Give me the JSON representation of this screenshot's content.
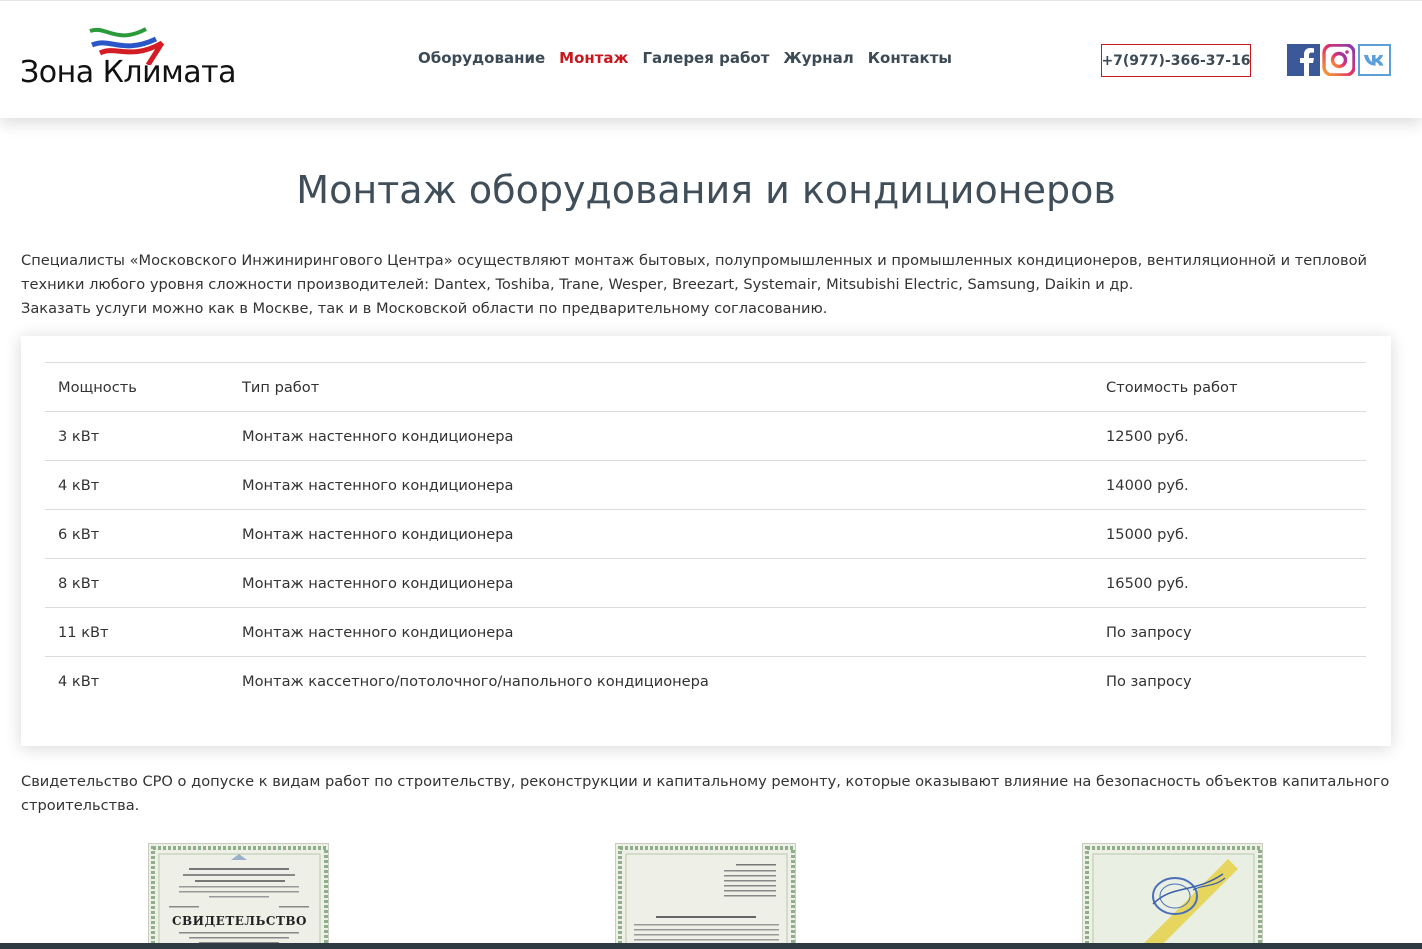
{
  "header": {
    "logo_text": "Зона Климата",
    "nav": [
      {
        "label": "Оборудование",
        "active": false
      },
      {
        "label": "Монтаж",
        "active": true
      },
      {
        "label": "Галерея работ",
        "active": false
      },
      {
        "label": "Журнал",
        "active": false
      },
      {
        "label": "Контакты",
        "active": false
      }
    ],
    "phone": "+7(977)-366-37-16",
    "social": [
      "facebook-icon",
      "instagram-icon",
      "vk-icon"
    ]
  },
  "main": {
    "title": "Монтаж оборудования и кондиционеров",
    "intro_line_1": "Специалисты «Московского Инжинирингового Центра» осуществляют монтаж бытовых, полупромышленных и промышленных кондиционеров, вентиляционной и тепловой техники любого уровня сложности производителей: Dantex, Toshiba, Trane, Wesper, Breezart, Systemair, Mitsubishi Electric, Samsung, Daikin и др.",
    "intro_line_2": "Заказать услуги можно как в Москве, так и в Московской области по предварительному согласованию.",
    "table": {
      "headers": [
        "Мощность",
        "Тип работ",
        "Стоимость работ"
      ],
      "rows": [
        [
          "3 кВт",
          "Монтаж настенного кондиционера",
          "12500 руб."
        ],
        [
          "4 кВт",
          "Монтаж настенного кондиционера",
          "14000 руб."
        ],
        [
          "6 кВт",
          "Монтаж настенного кондиционера",
          "15000 руб."
        ],
        [
          "8 кВт",
          "Монтаж настенного кондиционера",
          "16500 руб."
        ],
        [
          "11 кВт",
          "Монтаж настенного кондиционера",
          "По запросу"
        ],
        [
          "4 кВт",
          "Монтаж кассетного/потолочного/напольного кондиционера",
          "По запросу"
        ]
      ]
    },
    "sro_text": "Свидетельство СРО о допуске к видам работ по строительству, реконструкции и капитальному ремонту, которые оказывают влияние на безопасность объектов капитального строительства.",
    "certificates": [
      {
        "heading": "СВИДЕТЕЛЬСТВО"
      }
    ]
  },
  "colors": {
    "accent": "#c8181e",
    "nav_text": "#3b4a55",
    "title_text": "#3f4e59",
    "footer_bar": "#2e3b42"
  }
}
